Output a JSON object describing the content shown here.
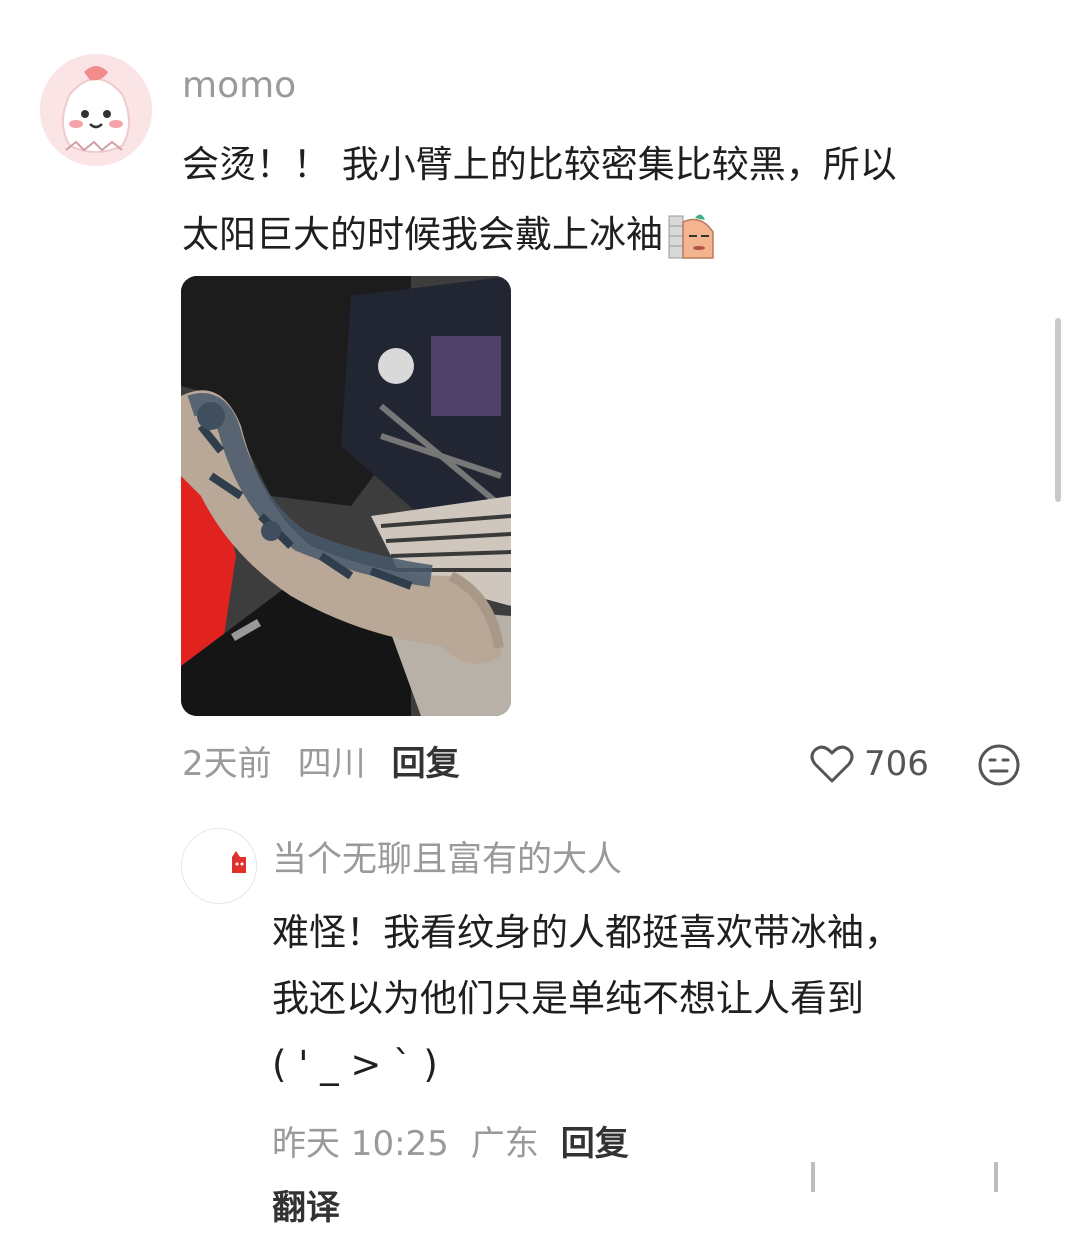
{
  "main_comment": {
    "username": "momo",
    "text_line1": "会烫！！ 我小臂上的比较密集比较黑，所以",
    "text_line2": "太阳巨大的时候我会戴上冰袖",
    "time": "2天前",
    "location": "四川",
    "reply_label": "回复",
    "like_count": "706",
    "sticker_icon": "sneaky-peek-sticker"
  },
  "reply": {
    "username": "当个无聊且富有的大人",
    "text_line1": "难怪！我看纹身的人都挺喜欢带冰袖，",
    "text_line2": "我还以为他们只是单纯不想让人看到",
    "text_line3": "( ' _ > ` )",
    "time": "昨天 10:25",
    "location": "广东",
    "reply_label": "回复",
    "translate_label": "翻译"
  },
  "colors": {
    "secondary_text": "#9a9a9a",
    "primary_text": "#1f1f1f",
    "avatar_bg": "#fbe4e6"
  }
}
